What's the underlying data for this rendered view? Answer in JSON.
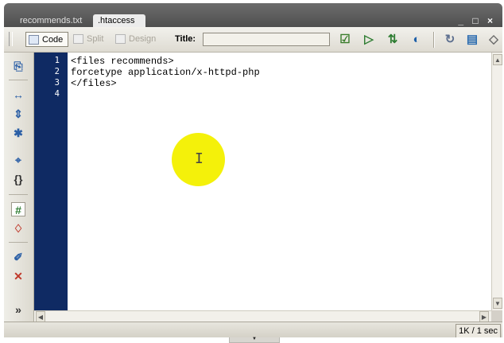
{
  "tabs": [
    {
      "label": "recommends.txt"
    },
    {
      "label": ".htaccess"
    }
  ],
  "window_controls": "_ □ ×",
  "toolbar": {
    "code_label": "Code",
    "split_label": "Split",
    "design_label": "Design",
    "title_label": "Title:",
    "title_value": "",
    "icons": [
      {
        "name": "validate-icon",
        "glyph": "☑"
      },
      {
        "name": "browser-check-icon",
        "glyph": "▷"
      },
      {
        "name": "file-management-icon",
        "glyph": "⇅"
      },
      {
        "name": "preview-browser-icon",
        "glyph": "◐"
      },
      {
        "name": "refresh-icon",
        "glyph": "↻"
      },
      {
        "name": "view-options-icon",
        "glyph": "▤"
      },
      {
        "name": "visual-aids-icon",
        "glyph": "◇"
      }
    ]
  },
  "sidebar_icons": [
    {
      "name": "open-documents-icon",
      "glyph": "⎘"
    },
    {
      "name": "collapse-full-tag-icon",
      "glyph": "↔"
    },
    {
      "name": "collapse-selection-icon",
      "glyph": "⇕"
    },
    {
      "name": "expand-all-icon",
      "glyph": "✱"
    },
    {
      "name": "select-parent-tag-icon",
      "glyph": "⌖"
    },
    {
      "name": "balance-braces-icon",
      "glyph": "{}"
    },
    {
      "name": "line-numbers-icon",
      "glyph": "#"
    },
    {
      "name": "highlight-invalid-code-icon",
      "glyph": "♢"
    },
    {
      "name": "apply-comment-icon",
      "glyph": "✐"
    },
    {
      "name": "remove-comment-icon",
      "glyph": "✕"
    },
    {
      "name": "more-tools-icon",
      "glyph": "»"
    }
  ],
  "code": {
    "line_numbers": [
      "1",
      "2",
      "3",
      "4"
    ],
    "lines": [
      "<files recommends>",
      "forcetype application/x-httpd-php",
      "</files>",
      ""
    ]
  },
  "status": {
    "size_time": "1K / 1 sec"
  },
  "cursor_glyph": "I"
}
